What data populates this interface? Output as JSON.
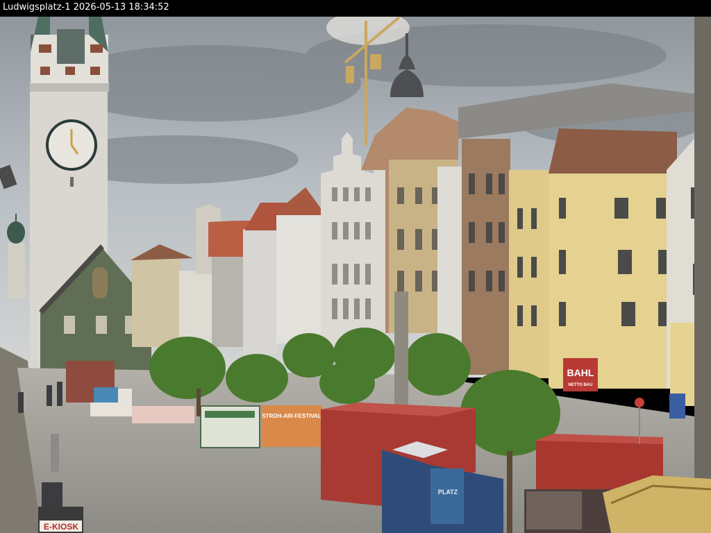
{
  "overlay": {
    "camera_label": "Ludwigsplatz-1 2026-05-13 18:34:52"
  },
  "signs": {
    "kiosk": "E-KIOSK",
    "festival_banner": "STROH-AIR-FESTIVAL",
    "bahl_sign": "BAHL",
    "bahl_sub": "NETTO BAU",
    "hoarding_text": "PLATZ"
  },
  "colors": {
    "sky": "#b9bfc4",
    "cloud_dark": "#6f757b",
    "tower": "#d6d4cc",
    "container_red": "#a83a33",
    "yellow_building": "#e6d28a",
    "tree_green": "#4a7a2e",
    "pavement": "#9c9a93"
  }
}
